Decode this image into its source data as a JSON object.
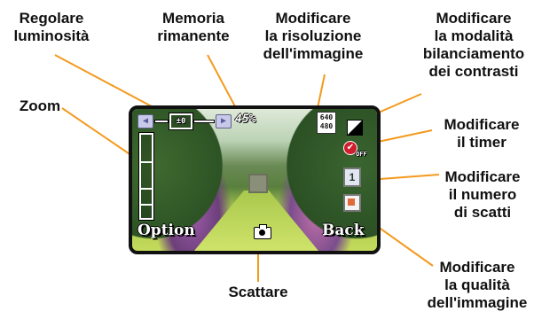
{
  "callouts": {
    "brightness": "Regolare\nluminosità",
    "memory": "Memoria\nrimanente",
    "resolution": "Modificare\nla risoluzione\ndell'immagine",
    "white_balance": "Modificare\nla modalità\nbilanciamento\ndei contrasti",
    "zoom": "Zoom",
    "timer": "Modificare\nil timer",
    "shots": "Modificare\nil numero\ndi scatti",
    "quality": "Modificare\nla qualità\ndell'immagine",
    "shoot": "Scattare"
  },
  "screen": {
    "ev_value": "±0",
    "left_arrow": "◀",
    "right_arrow": "▶",
    "memory_value": "45%",
    "resolution_top": "640",
    "resolution_bottom": "480",
    "timer_state": "OFF",
    "shots_value": "1",
    "option_label": "Option",
    "back_label": "Back"
  },
  "colors": {
    "callout_text": "#111111",
    "leader_line": "#f39a1e",
    "screen_border": "#111111",
    "timer_red": "#d01e2e"
  }
}
